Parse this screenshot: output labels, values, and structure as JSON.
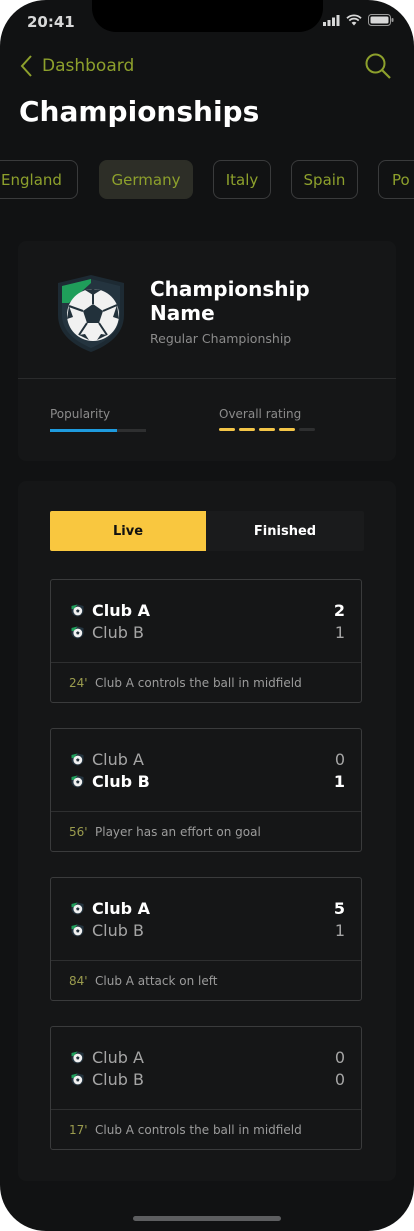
{
  "status": {
    "time": "20:41"
  },
  "nav": {
    "back_label": "Dashboard"
  },
  "page": {
    "title": "Championships"
  },
  "tabs": [
    {
      "label": "England"
    },
    {
      "label": "Germany",
      "active": true
    },
    {
      "label": "Italy"
    },
    {
      "label": "Spain"
    },
    {
      "label": "Po"
    }
  ],
  "championship": {
    "name": "Championship Name",
    "type": "Regular Championship",
    "popularity_label": "Popularity",
    "popularity_value": 0.7,
    "rating_label": "Overall rating",
    "rating_value": 4,
    "rating_max": 5
  },
  "segment": {
    "live_label": "Live",
    "finished_label": "Finished",
    "selected": "Live"
  },
  "matches": [
    {
      "team_a": "Club A",
      "team_b": "Club B",
      "score_a": "2",
      "score_b": "1",
      "winner": "a",
      "minute": "24'",
      "event": "Club A controls the ball in midfield"
    },
    {
      "team_a": "Club A",
      "team_b": "Club B",
      "score_a": "0",
      "score_b": "1",
      "winner": "b",
      "minute": "56'",
      "event": "Player has an effort on goal"
    },
    {
      "team_a": "Club A",
      "team_b": "Club B",
      "score_a": "5",
      "score_b": "1",
      "winner": "a",
      "minute": "84'",
      "event": "Club A attack on left"
    },
    {
      "team_a": "Club A",
      "team_b": "Club B",
      "score_a": "0",
      "score_b": "0",
      "winner": "none",
      "minute": "17'",
      "event": "Club A controls the ball in midfield"
    }
  ],
  "colors": {
    "accent": "#8da02c",
    "live": "#f9c73f",
    "popularity": "#1e9bde",
    "rating": "#f3c548"
  }
}
